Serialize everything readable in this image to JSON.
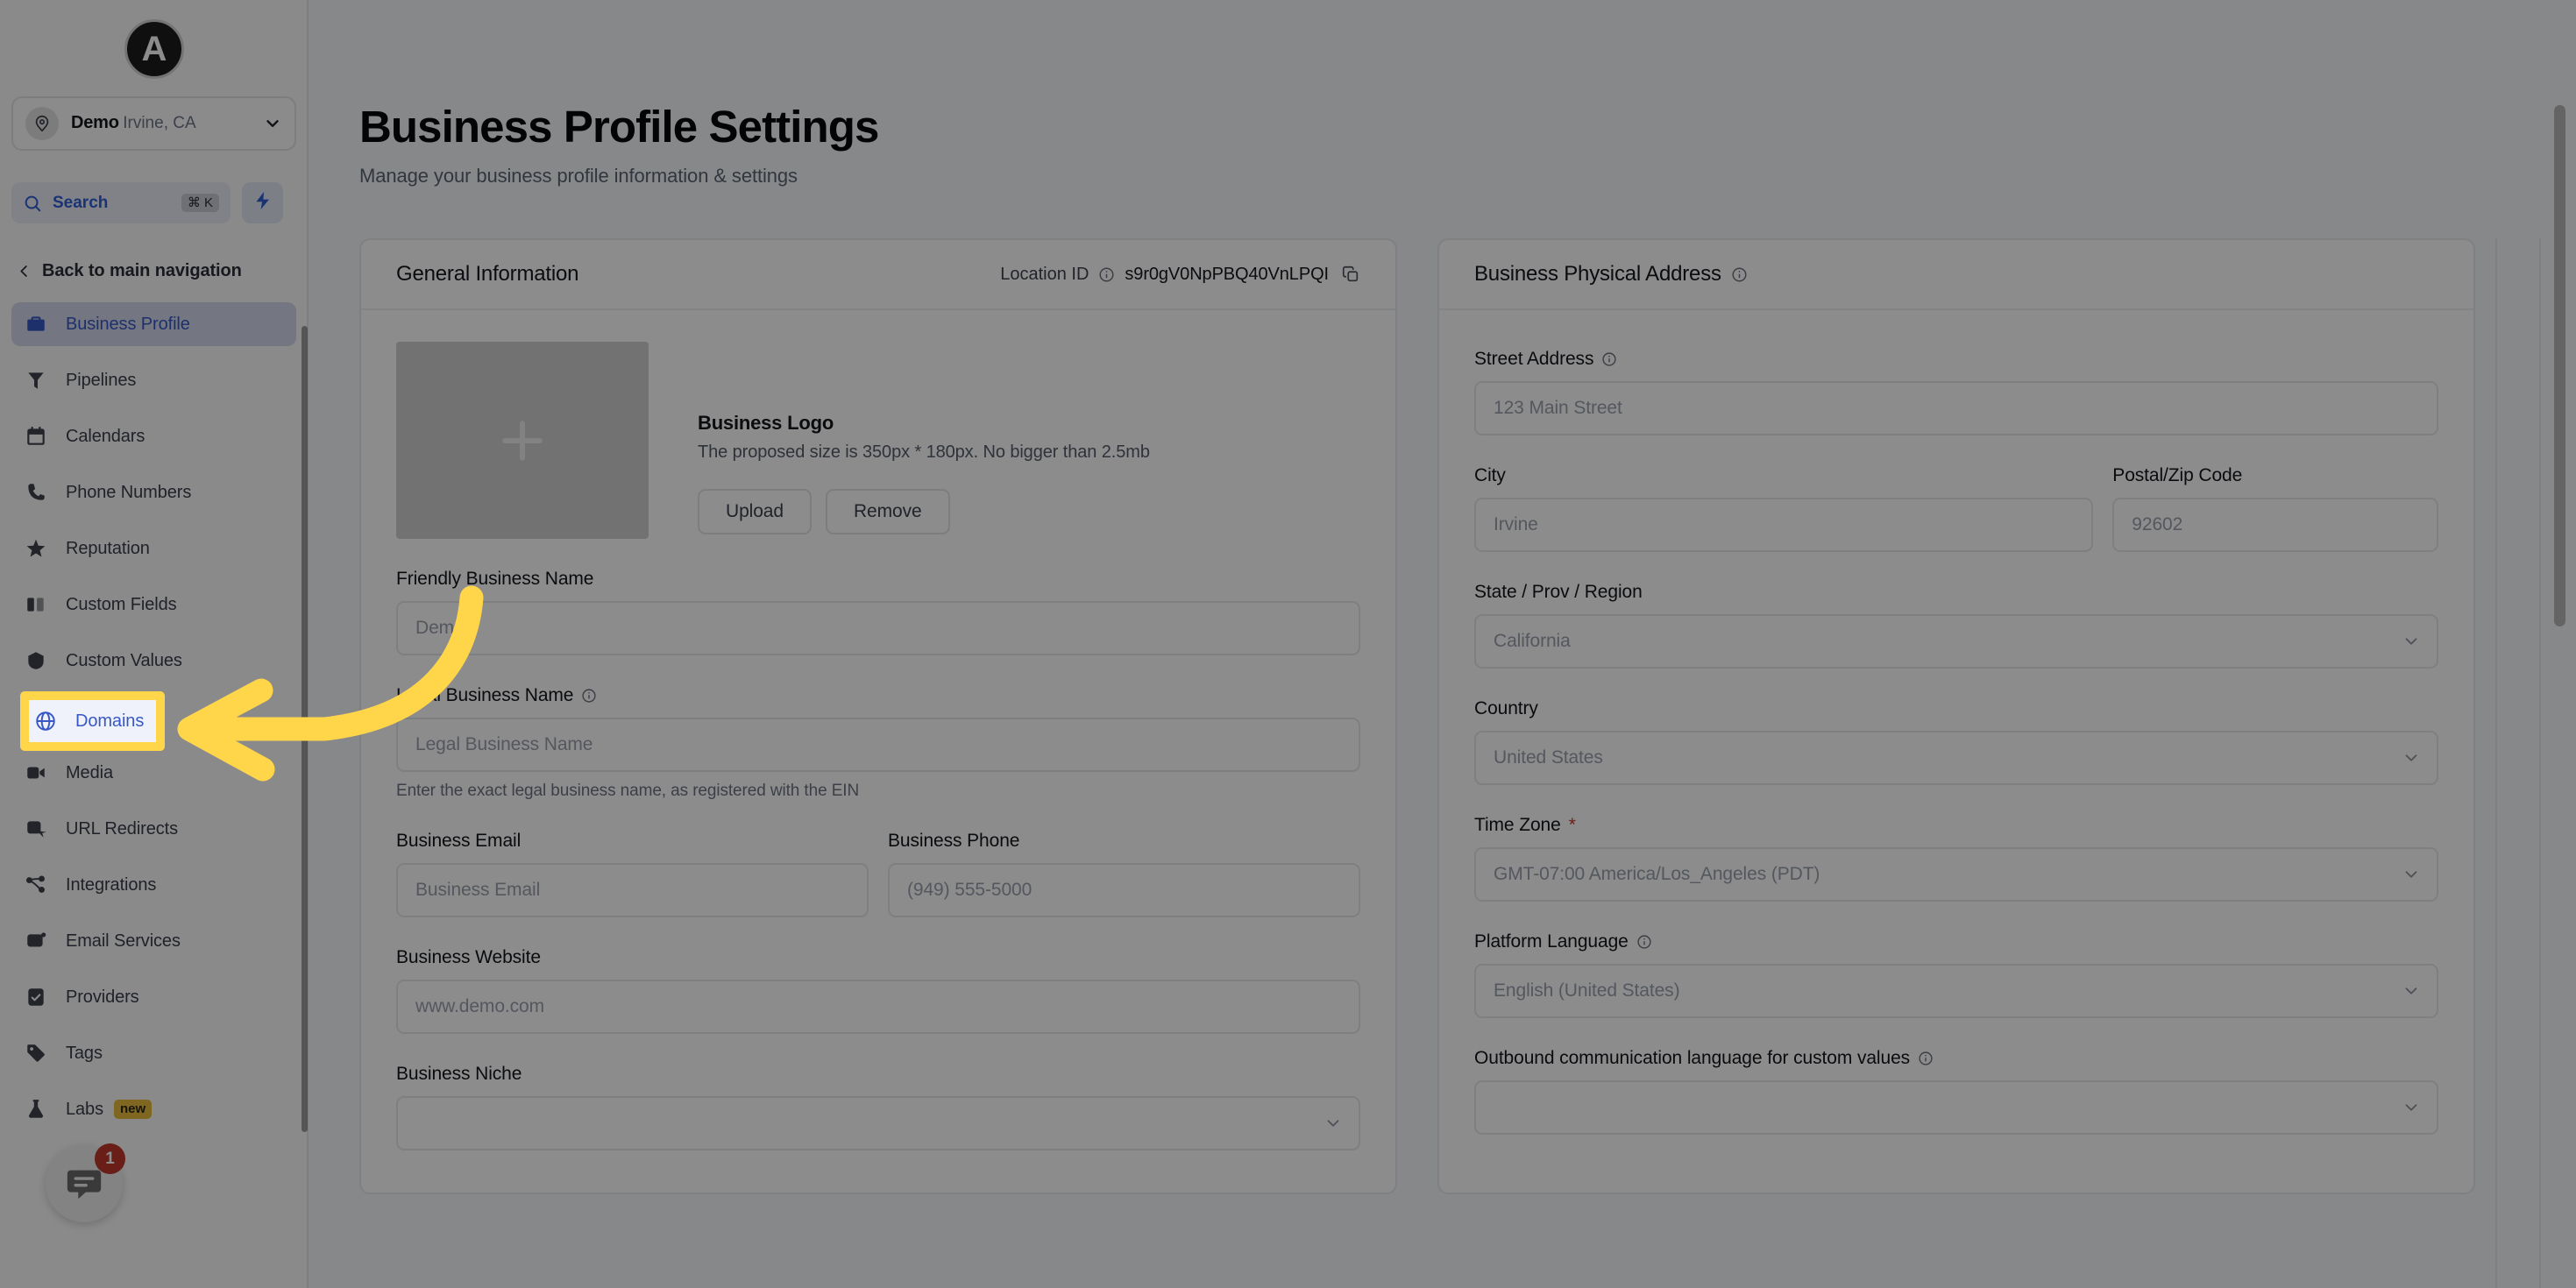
{
  "sidebar": {
    "brand": {
      "glyph": "A",
      "name": "brand-logo"
    },
    "location": {
      "name": "Demo",
      "sublabel": "Irvine, CA"
    },
    "search": {
      "label": "Search",
      "shortcut": "⌘ K"
    },
    "back_nav": {
      "label": "Back to main navigation"
    },
    "items": [
      {
        "label": "Business Profile",
        "icon": "briefcase-icon",
        "active": true
      },
      {
        "label": "Pipelines",
        "icon": "funnel-icon",
        "active": false
      },
      {
        "label": "Calendars",
        "icon": "calendar-icon",
        "active": false
      },
      {
        "label": "Phone Numbers",
        "icon": "phone-icon",
        "active": false
      },
      {
        "label": "Reputation",
        "icon": "star-icon",
        "active": false
      },
      {
        "label": "Custom Fields",
        "icon": "fields-icon",
        "active": false
      },
      {
        "label": "Custom Values",
        "icon": "values-icon",
        "active": false
      },
      {
        "label": "Domains",
        "icon": "globe-icon",
        "active": false,
        "highlighted": true
      },
      {
        "label": "Media",
        "icon": "media-icon",
        "active": false
      },
      {
        "label": "URL Redirects",
        "icon": "redirect-icon",
        "active": false
      },
      {
        "label": "Integrations",
        "icon": "integrations-icon",
        "active": false
      },
      {
        "label": "Email Services",
        "icon": "email-icon",
        "active": false
      },
      {
        "label": "Providers",
        "icon": "providers-icon",
        "active": false
      },
      {
        "label": "Tags",
        "icon": "tag-icon",
        "active": false
      },
      {
        "label": "Labs",
        "icon": "flask-icon",
        "active": false,
        "badge": "new"
      }
    ],
    "chat": {
      "badge_count": "1",
      "icon": "chat-bubble-icon"
    }
  },
  "header": {
    "title": "Business Profile Settings",
    "subtitle": "Manage your business profile information & settings"
  },
  "general_information": {
    "card_title": "General Information",
    "location_id_label": "Location ID",
    "location_id_value": "s9r0gV0NpPBQ40VnLPQI",
    "logo": {
      "heading": "Business Logo",
      "description": "The proposed size is 350px * 180px. No bigger than 2.5mb",
      "upload_label": "Upload",
      "remove_label": "Remove"
    },
    "fields": {
      "friendly_business_name": {
        "label": "Friendly Business Name",
        "placeholder": "Demo"
      },
      "legal_business_name": {
        "label": "Legal Business Name",
        "placeholder": "Legal Business Name",
        "help": "Enter the exact legal business name, as registered with the EIN"
      },
      "business_email": {
        "label": "Business Email",
        "placeholder": "Business Email"
      },
      "business_phone": {
        "label": "Business Phone",
        "placeholder": "(949) 555-5000"
      },
      "business_website": {
        "label": "Business Website",
        "placeholder": "www.demo.com"
      },
      "business_niche": {
        "label": "Business Niche",
        "placeholder": ""
      }
    }
  },
  "physical_address": {
    "card_title": "Business Physical Address",
    "fields": {
      "street_address": {
        "label": "Street Address",
        "placeholder": "123 Main Street"
      },
      "city": {
        "label": "City",
        "placeholder": "Irvine"
      },
      "postal_code": {
        "label": "Postal/Zip Code",
        "placeholder": "92602"
      },
      "state": {
        "label": "State / Prov / Region",
        "placeholder": "California"
      },
      "country": {
        "label": "Country",
        "placeholder": "United States"
      },
      "time_zone": {
        "label": "Time Zone",
        "required": "*",
        "placeholder": "GMT-07:00 America/Los_Angeles (PDT)"
      },
      "platform_language": {
        "label": "Platform Language",
        "placeholder": "English (United States)"
      },
      "outbound_language": {
        "label": "Outbound communication language for custom values",
        "placeholder": ""
      }
    }
  },
  "annotation": {
    "highlight_target": "Domains",
    "highlight_color": "#ffd54a",
    "arrow_color": "#ffd54a"
  },
  "colors": {
    "accent_blue": "#3758c5",
    "highlight_yellow": "#ffd54a",
    "badge_red": "#c0392b",
    "badge_gold": "#e8bc3e"
  }
}
